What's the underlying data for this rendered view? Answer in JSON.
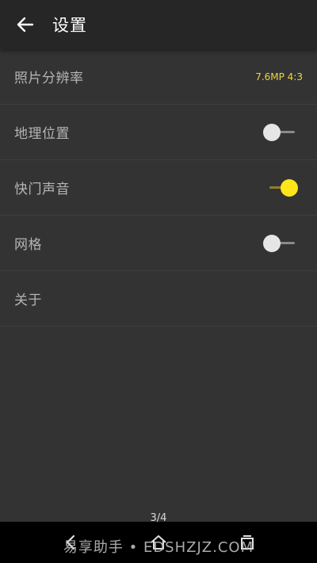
{
  "header": {
    "title": "设置"
  },
  "settings": {
    "items": [
      {
        "label": "照片分辨率",
        "value": "7.6MP 4:3"
      },
      {
        "label": "地理位置",
        "toggle": false
      },
      {
        "label": "快门声音",
        "toggle": true
      },
      {
        "label": "网格",
        "toggle": false
      },
      {
        "label": "关于"
      }
    ]
  },
  "navigation": {
    "page_indicator": "3/4",
    "watermark": "易享助手 • EDSHZJZ.COM"
  },
  "colors": {
    "accent": "#ffe51a",
    "background": "#333333",
    "app_bar": "#262626"
  }
}
